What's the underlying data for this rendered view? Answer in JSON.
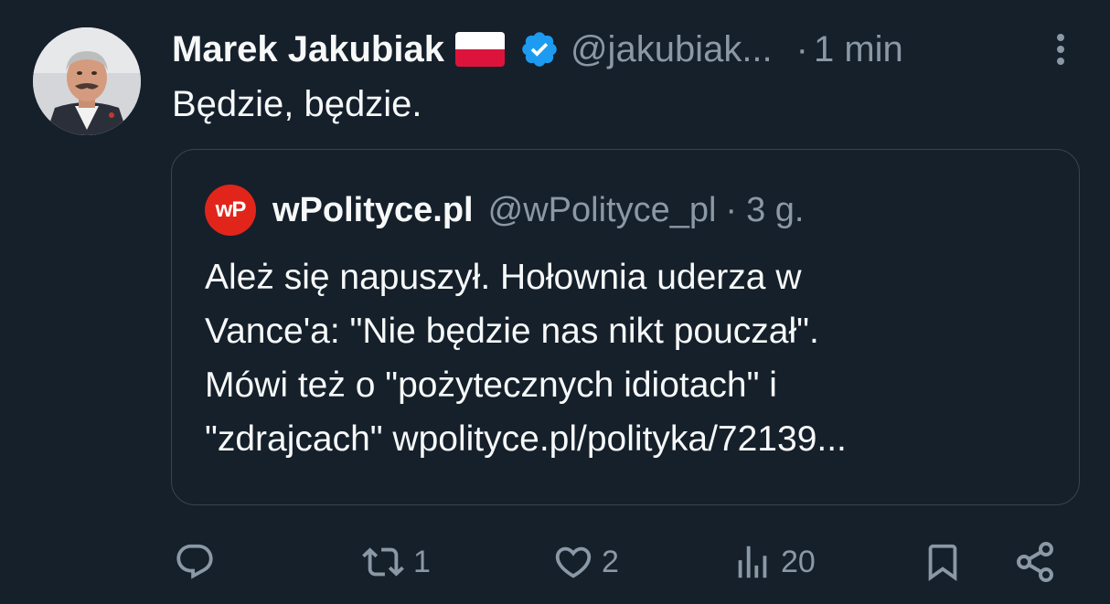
{
  "tweet": {
    "author": {
      "display_name": "Marek Jakubiak",
      "handle": "@jakubiak...",
      "avatar_icon": "profile-photo",
      "flag_icon": "poland-flag-icon",
      "verified_icon": "verified-badge-icon"
    },
    "separator": "·",
    "time": "1 min",
    "text": "Będzie, będzie.",
    "quote": {
      "avatar_label": "wP",
      "display_name": "wPolityce.pl",
      "handle": "@wPolityce_pl",
      "separator": "·",
      "time": "3 g.",
      "lines": [
        "Ależ się napuszył. Hołownia uderza w",
        "Vance'a: \"Nie będzie nas nikt pouczał\".",
        "Mówi też o \"pożytecznych idiotach\" i",
        "\"zdrajcach\" wpolityce.pl/polityka/72139..."
      ]
    },
    "actions": {
      "reply_count": "",
      "retweet_count": "1",
      "like_count": "2",
      "views_count": "20"
    }
  },
  "colors": {
    "background": "#15202b",
    "text_primary": "#f7f9f9",
    "text_secondary": "#8b98a5",
    "border": "#38444d",
    "verified": "#1d9bf0",
    "wpolityce_red": "#e1251b"
  }
}
